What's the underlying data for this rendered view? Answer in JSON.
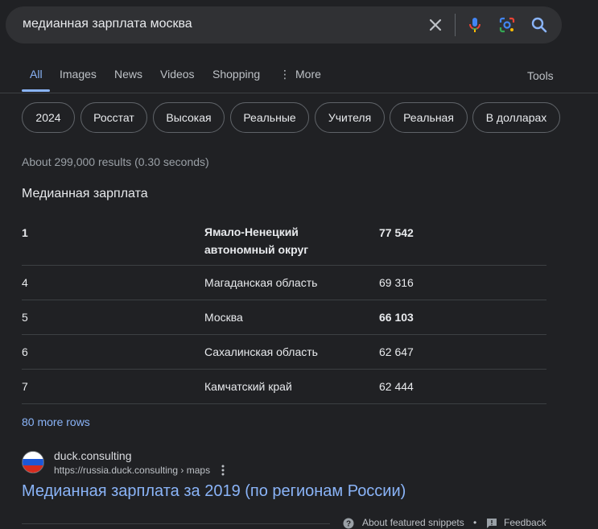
{
  "search": {
    "query": "медианная зарплата москва"
  },
  "tabs": [
    {
      "label": "All"
    },
    {
      "label": "Images"
    },
    {
      "label": "News"
    },
    {
      "label": "Videos"
    },
    {
      "label": "Shopping"
    },
    {
      "label": "More"
    }
  ],
  "tools_label": "Tools",
  "chips": [
    "2024",
    "Росстат",
    "Высокая",
    "Реальные",
    "Учителя",
    "Реальная",
    "В долларах"
  ],
  "result_stats": "About 299,000 results (0.30 seconds)",
  "snippet": {
    "title": "Медианная зарплата",
    "rows": [
      {
        "rank": "1",
        "region": "Ямало-Ненецкий автономный округ",
        "salary": "77 542"
      },
      {
        "rank": "4",
        "region": "Магаданская область",
        "salary": "69 316"
      },
      {
        "rank": "5",
        "region": "Москва",
        "salary": "66 103"
      },
      {
        "rank": "6",
        "region": "Сахалинская область",
        "salary": "62 647"
      },
      {
        "rank": "7",
        "region": "Камчатский край",
        "salary": "62 444"
      }
    ],
    "more_rows": "80 more rows"
  },
  "result": {
    "site_name": "duck.consulting",
    "url": "https://russia.duck.consulting › maps",
    "title": "Медианная зарплата за 2019 (по регионам России)"
  },
  "footer": {
    "about_label": "About featured snippets",
    "separator": "•",
    "feedback_label": "Feedback"
  },
  "colors": {
    "background": "#202124",
    "search_box": "#303134",
    "link": "#8ab4f8",
    "text": "#e8eaed",
    "muted": "#9aa0a6"
  },
  "icons": [
    "close-icon",
    "mic-icon",
    "lens-icon",
    "search-icon",
    "more-vert-icon",
    "russian-flag-icon",
    "help-icon",
    "feedback-icon"
  ]
}
